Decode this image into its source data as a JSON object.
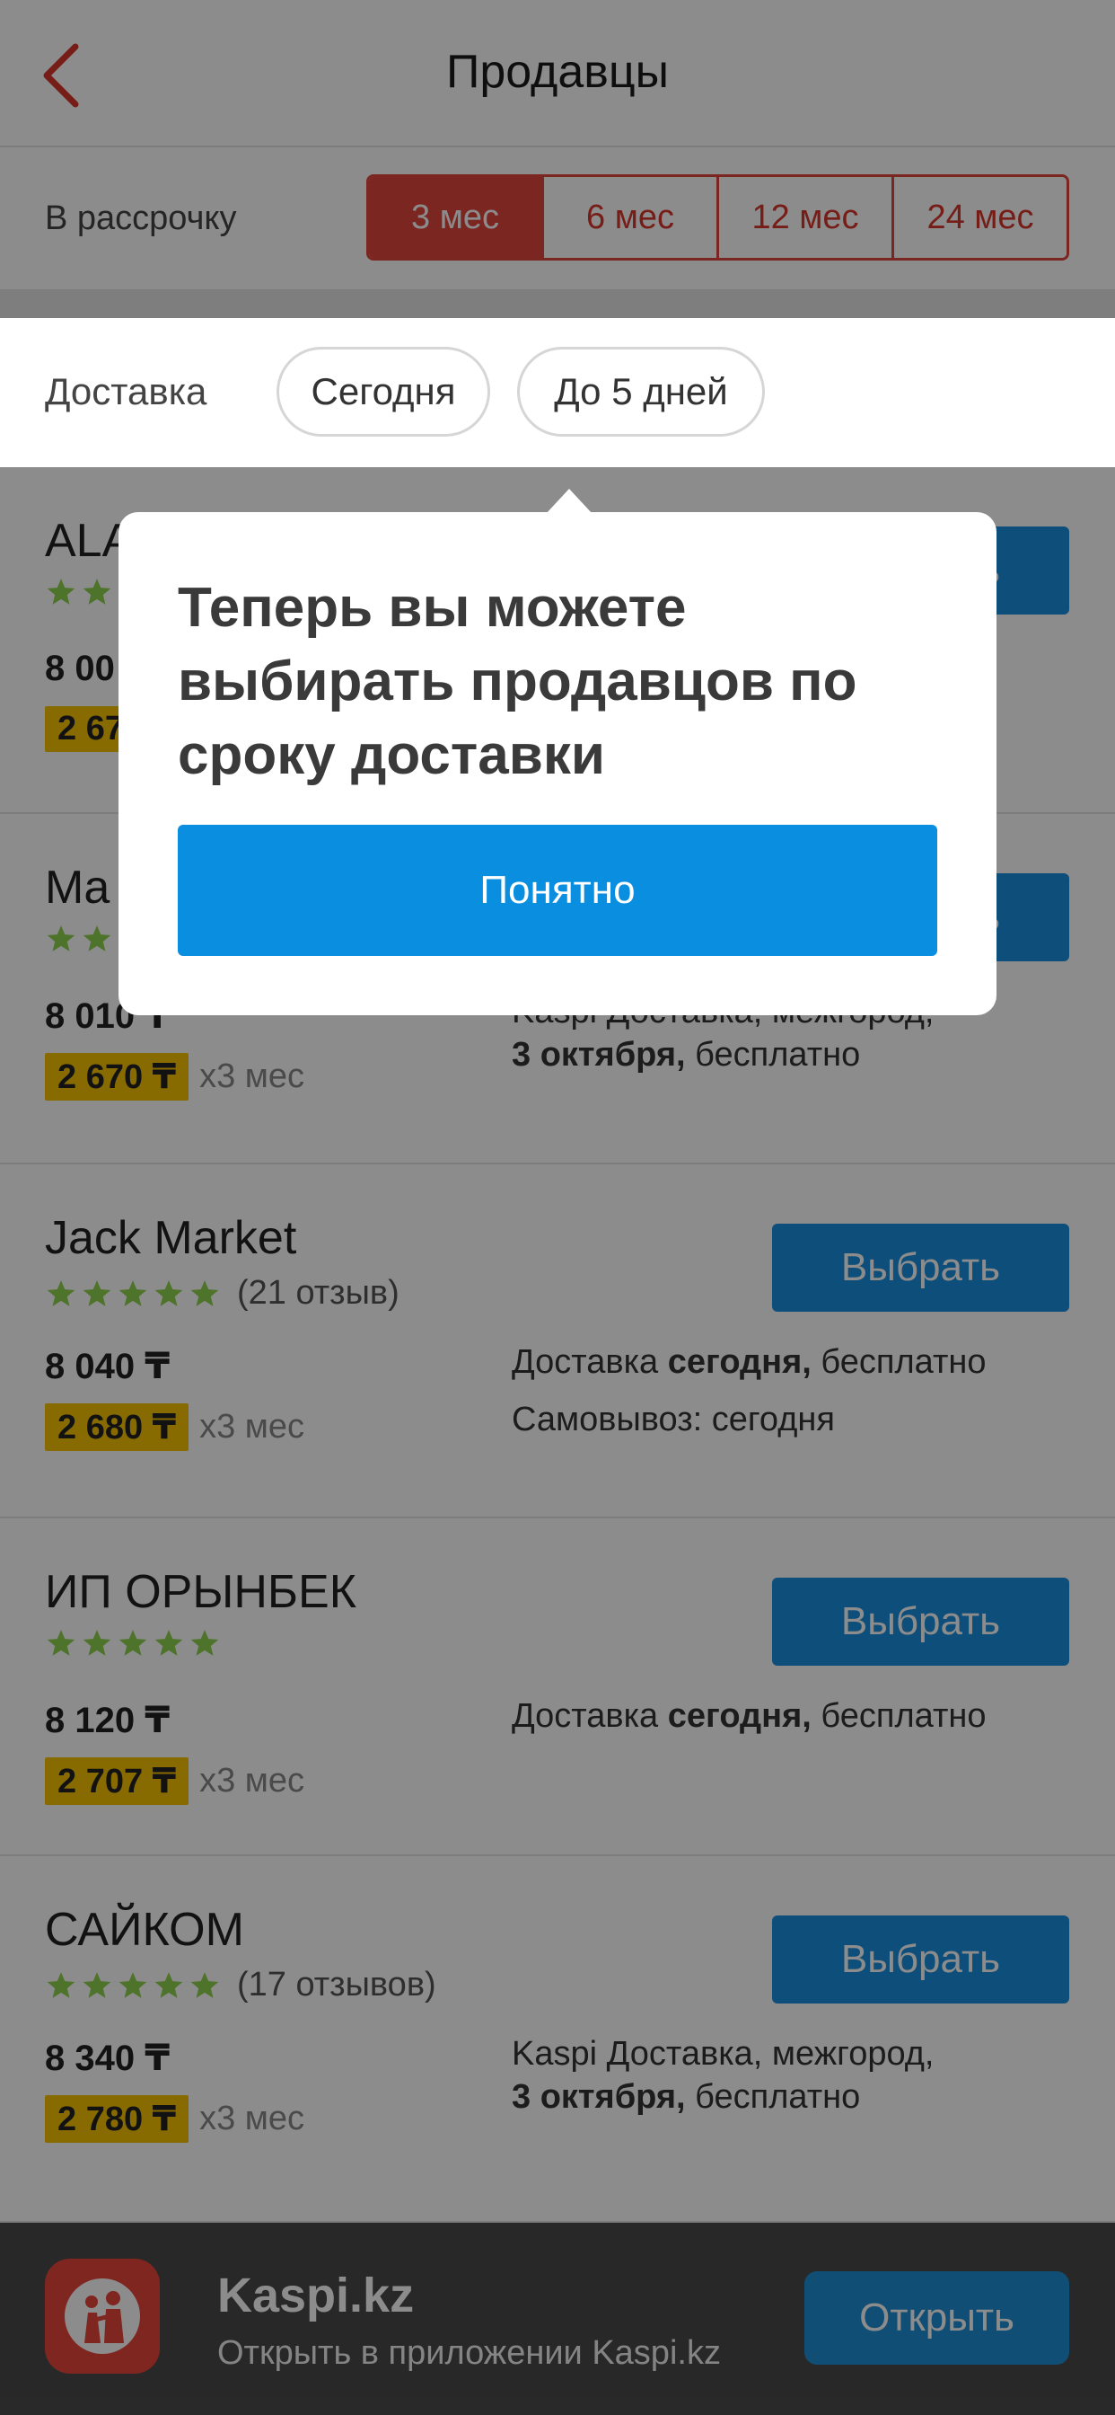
{
  "header": {
    "title": "Продавцы"
  },
  "installment": {
    "label": "В рассрочку",
    "periods": [
      "3 мес",
      "6 мес",
      "12 мес",
      "24 мес"
    ],
    "selected": "3 мес"
  },
  "delivery_filter": {
    "label": "Доставка",
    "chips": [
      "Сегодня",
      "До 5 дней"
    ]
  },
  "popup": {
    "title": "Теперь вы можете выбирать продавцов по сроку доставки",
    "button": "Понятно"
  },
  "sellers": [
    {
      "name": "ALA",
      "rating": 5,
      "reviews": "",
      "price": "8 00",
      "installment": "2 67",
      "months": "",
      "button": "Выбрать",
      "delivery_lines": []
    },
    {
      "name": "Ma",
      "rating": 5,
      "reviews": "",
      "price": "8 010 ₸",
      "installment": "2 670 ₸",
      "months": "x3 мес",
      "button": "Выбрать",
      "delivery_lines": [
        {
          "pre": "Kaspi Доставка, межгород,",
          "bold": "",
          "post": ""
        },
        {
          "pre": "",
          "bold": "3 октября,",
          "post": " бесплатно"
        }
      ]
    },
    {
      "name": "Jack Market",
      "rating": 5,
      "reviews": "(21 отзыв)",
      "price": "8 040 ₸",
      "installment": "2 680 ₸",
      "months": "x3 мес",
      "button": "Выбрать",
      "delivery_lines": [
        {
          "pre": "Доставка ",
          "bold": "сегодня,",
          "post": " бесплатно"
        },
        {
          "pre": "Самовывоз: сегодня",
          "bold": "",
          "post": ""
        }
      ]
    },
    {
      "name": "ИП ОРЫНБЕК",
      "rating": 5,
      "reviews": "",
      "price": "8 120 ₸",
      "installment": "2 707 ₸",
      "months": "x3 мес",
      "button": "Выбрать",
      "delivery_lines": [
        {
          "pre": "Доставка ",
          "bold": "сегодня,",
          "post": " бесплатно"
        }
      ]
    },
    {
      "name": "САЙКОМ",
      "rating": 5,
      "reviews": "(17 отзывов)",
      "price": "8 340 ₸",
      "installment": "2 780 ₸",
      "months": "x3 мес",
      "button": "Выбрать",
      "delivery_lines": [
        {
          "pre": "Kaspi Доставка, межгород,",
          "bold": "",
          "post": ""
        },
        {
          "pre": "",
          "bold": "3 октября,",
          "post": " бесплатно"
        }
      ]
    }
  ],
  "app_banner": {
    "name": "Kaspi.kz",
    "subtitle": "Открыть в приложении Kaspi.kz",
    "button": "Открыть"
  },
  "colors": {
    "accent_red": "#e2463c",
    "button_blue": "#1a8fde",
    "star_green": "#8fd14f",
    "installment_yellow": "#f6c400"
  },
  "icons": [
    "back-arrow-icon",
    "star-icon",
    "kaspi-logo-icon"
  ]
}
